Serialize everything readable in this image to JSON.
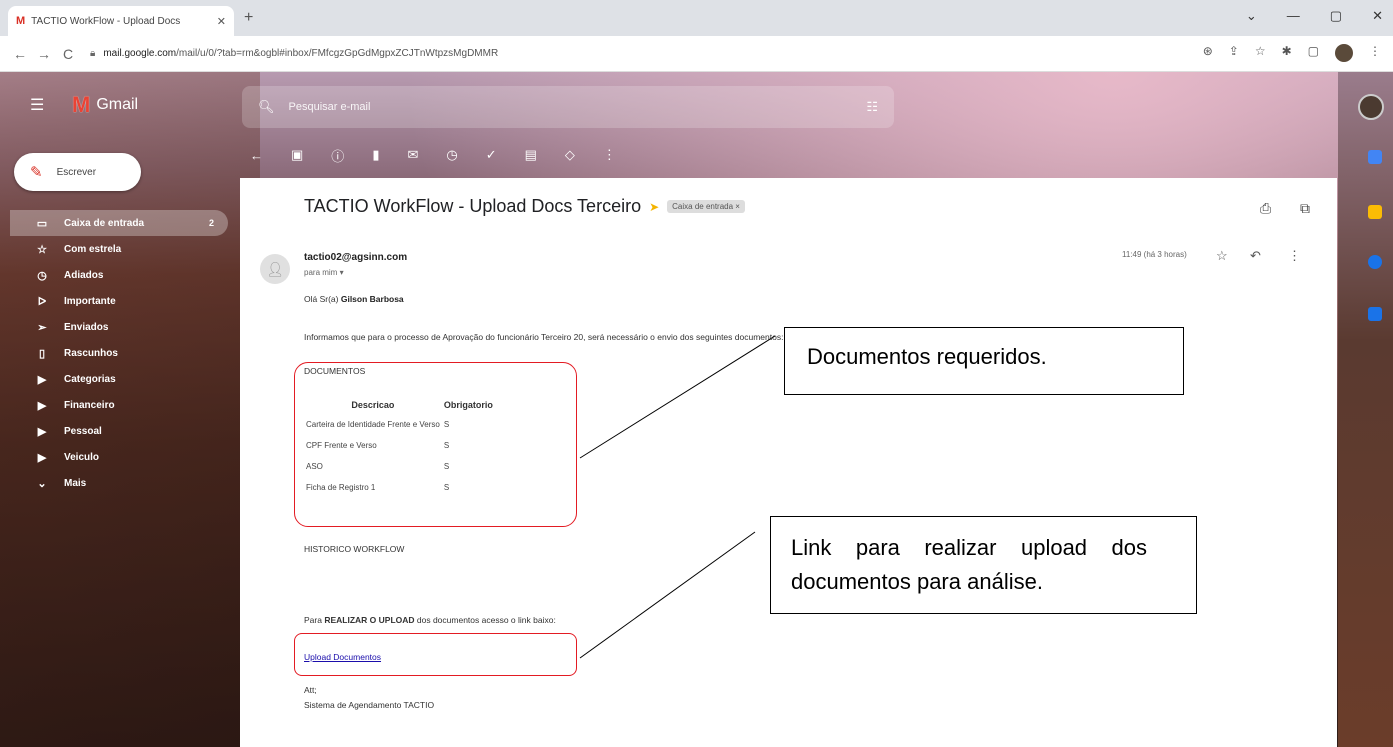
{
  "browser": {
    "tab_title": "TACTIO WorkFlow - Upload Docs",
    "tab_favicon": "M",
    "tab_close": "✕",
    "new_tab": "+",
    "url_domain": "mail.google.com",
    "url_path": "/mail/u/0/?tab=rm&ogbl#inbox/FMfcgzGpGdMgpxZCJTnWtpzsMgDMMR",
    "win_buttons": [
      "⌄",
      "—",
      "▢",
      "✕"
    ],
    "nav": {
      "back": "←",
      "forward": "→",
      "reload": "C"
    }
  },
  "gmail": {
    "logo_text": "Gmail",
    "search_placeholder": "Pesquisar e-mail",
    "compose_label": "Escrever",
    "nav_items": [
      {
        "label": "Caixa de entrada",
        "icon": "inbox-icon",
        "count": "2",
        "active": true
      },
      {
        "label": "Com estrela",
        "icon": "star-icon"
      },
      {
        "label": "Adiados",
        "icon": "clock-icon"
      },
      {
        "label": "Importante",
        "icon": "important-icon"
      },
      {
        "label": "Enviados",
        "icon": "send-icon"
      },
      {
        "label": "Rascunhos",
        "icon": "draft-icon"
      },
      {
        "label": "Categorias",
        "icon": "label-icon"
      },
      {
        "label": "Financeiro",
        "icon": "label-icon"
      },
      {
        "label": "Pessoal",
        "icon": "label-icon"
      },
      {
        "label": "Veiculo",
        "icon": "label-icon"
      },
      {
        "label": "Mais",
        "icon": "chevron-down-icon"
      }
    ]
  },
  "message": {
    "subject": "TACTIO WorkFlow - Upload Docs Terceiro",
    "label_chip": "Caixa de entrada ×",
    "sender": "tactio02@agsinn.com",
    "to": "para mim ▾",
    "time": "11:49 (há 3 horas)",
    "greeting_prefix": "Olá Sr(a) ",
    "greeting_name": "Gilson Barbosa",
    "intro": "Informamos que para o processo de Aprovação do funcionário Terceiro 20, será necessário o envio dos seguintes documentos:",
    "documents_heading": "DOCUMENTOS",
    "table": {
      "headers": [
        "Descricao",
        "Obrigatorio"
      ],
      "rows": [
        [
          "Carteira de Identidade Frente e Verso",
          "S"
        ],
        [
          "CPF Frente e Verso",
          "S"
        ],
        [
          "ASO",
          "S"
        ],
        [
          "Ficha de Registro 1",
          "S"
        ]
      ]
    },
    "history_heading": "HISTORICO WORKFLOW",
    "upload_prefix": "Para ",
    "upload_bold": "REALIZAR O UPLOAD",
    "upload_suffix": " dos documentos acesso o link baixo:",
    "upload_link": "Upload Documentos",
    "closing": "Att;",
    "signature": "Sistema de Agendamento TACTIO"
  },
  "annotations": {
    "callout_1": "Documentos requeridos.",
    "callout_2": "Link para realizar upload dos documentos para análise.",
    "box_color": "#e31b23"
  }
}
